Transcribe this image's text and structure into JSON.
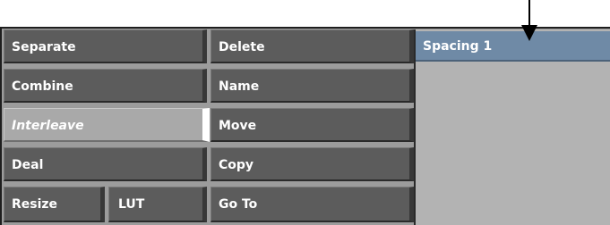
{
  "left_column": {
    "separate": "Separate",
    "combine": "Combine",
    "interleave": "Interleave",
    "deal": "Deal",
    "resize": "Resize",
    "lut": "LUT"
  },
  "middle_column": {
    "delete": "Delete",
    "name": "Name",
    "move": "Move",
    "copy": "Copy",
    "goto": "Go To"
  },
  "spacing_field": {
    "value": "Spacing 1"
  },
  "colors": {
    "button": "#5c5c5c",
    "active_button": "#a9a9a9",
    "field": "#6f8aa6",
    "panel": "#9c9c9c"
  }
}
